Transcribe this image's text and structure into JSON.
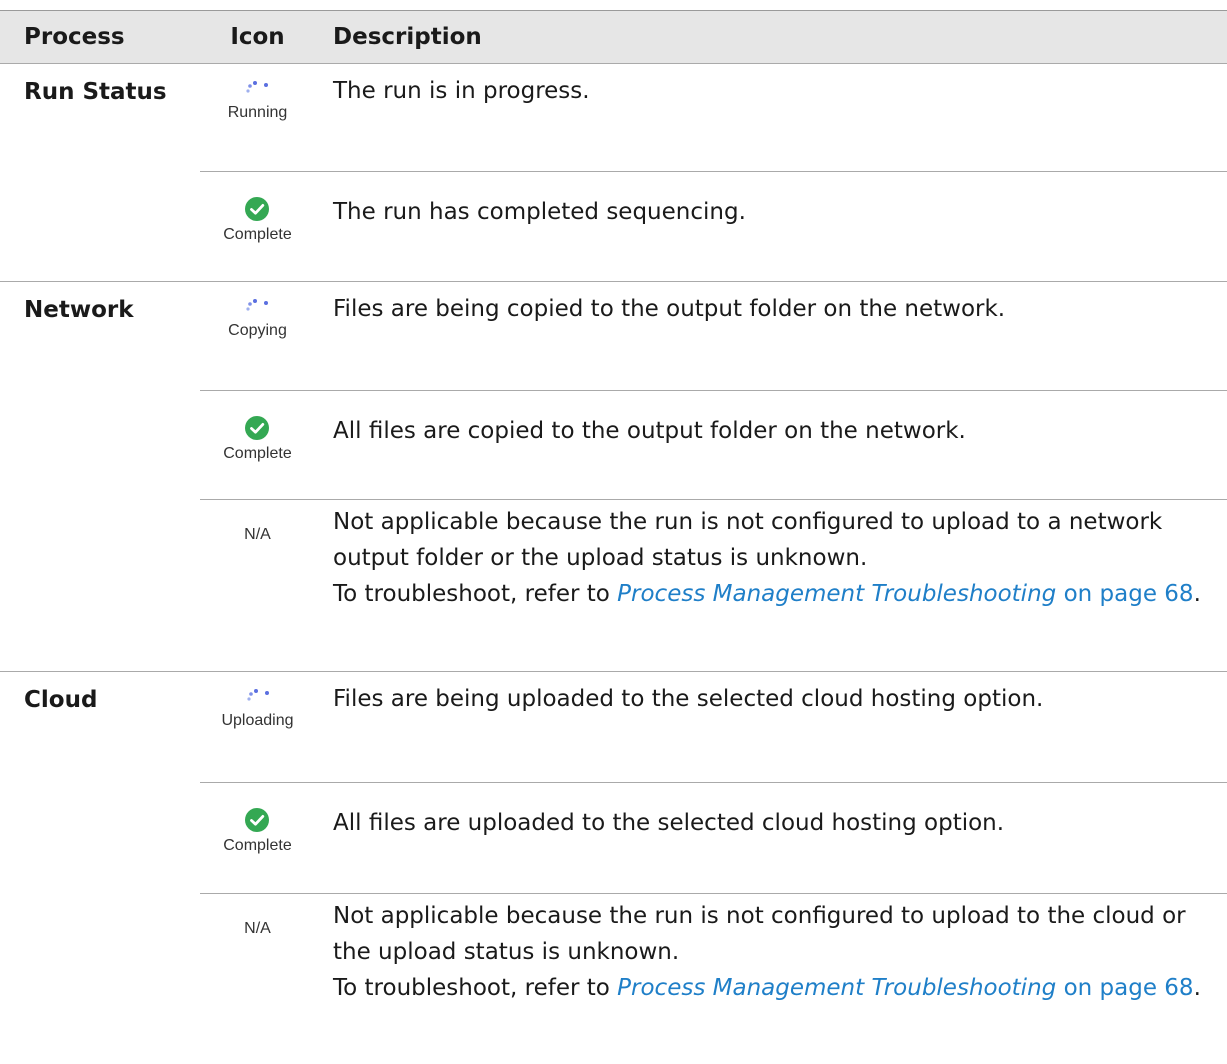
{
  "header": {
    "process": "Process",
    "icon": "Icon",
    "description": "Description"
  },
  "colors": {
    "complete_green": "#34a853",
    "running_blue": "#5b6fe0",
    "link_blue": "#1f7fc8",
    "header_bg": "#e6e6e6"
  },
  "groups": [
    {
      "process": "Run Status",
      "rows": [
        {
          "icon": "spinner-icon",
          "icon_label": "Running",
          "description": "The run is in progress."
        },
        {
          "icon": "check-circle-icon",
          "icon_label": "Complete",
          "description": "The run has completed sequencing."
        }
      ]
    },
    {
      "process": "Network",
      "rows": [
        {
          "icon": "spinner-icon",
          "icon_label": "Copying",
          "description": "Files are being copied to the output folder on the network."
        },
        {
          "icon": "check-circle-icon",
          "icon_label": "Complete",
          "description": "All files are copied to the output folder on the network."
        },
        {
          "icon": "none",
          "icon_label": "N/A",
          "description": "Not applicable because the run is not configured to upload to a network output folder or the upload status is unknown.",
          "troubleshoot_prefix": "To troubleshoot, refer to",
          "link_text": "Process Management Troubleshooting",
          "link_on": "on",
          "link_page": "page 68",
          "period": "."
        }
      ]
    },
    {
      "process": "Cloud",
      "rows": [
        {
          "icon": "spinner-icon",
          "icon_label": "Uploading",
          "description": "Files are being uploaded to the selected cloud hosting option."
        },
        {
          "icon": "check-circle-icon",
          "icon_label": "Complete",
          "description": "All files are uploaded to the selected cloud hosting option."
        },
        {
          "icon": "none",
          "icon_label": "N/A",
          "description": "Not applicable because the run is not configured to upload to the cloud or the upload status is unknown.",
          "troubleshoot_prefix": "To troubleshoot, refer to",
          "link_text": "Process Management Troubleshooting",
          "link_on": "on",
          "link_page": "page 68",
          "period": "."
        }
      ]
    }
  ]
}
